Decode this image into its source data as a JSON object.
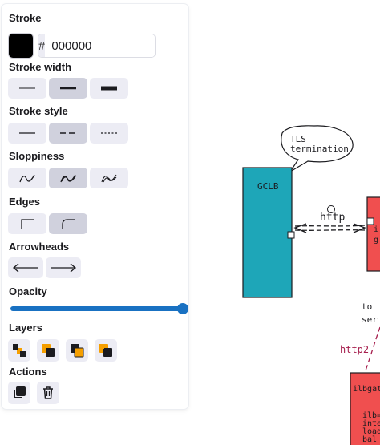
{
  "colors": {
    "accent": "#1971c2",
    "stroke_hex": "#000000",
    "gclb_fill": "#1ea6b8",
    "red_fill": "#f04f4f",
    "http2_text": "#a61e4d",
    "orange": "#f59f00"
  },
  "panel": {
    "stroke": {
      "title": "Stroke",
      "hash": "#",
      "value": "000000"
    },
    "stroke_width": {
      "title": "Stroke width",
      "options": [
        "thin",
        "bold",
        "extra-bold"
      ],
      "selected": 1
    },
    "stroke_style": {
      "title": "Stroke style",
      "options": [
        "solid",
        "dashed",
        "dotted"
      ],
      "selected": 1
    },
    "sloppiness": {
      "title": "Sloppiness",
      "options": [
        "architect",
        "artist",
        "cartoonist"
      ],
      "selected": 1
    },
    "edges": {
      "title": "Edges",
      "options": [
        "sharp",
        "round"
      ],
      "selected": 1
    },
    "arrowheads": {
      "title": "Arrowheads",
      "options": [
        "arrow-left-icon",
        "arrow-right-icon"
      ]
    },
    "opacity": {
      "title": "Opacity",
      "value": 100
    },
    "layers": {
      "title": "Layers",
      "options": [
        "send-to-back-icon",
        "send-backward-icon",
        "bring-forward-icon",
        "bring-to-front-icon"
      ]
    },
    "actions": {
      "title": "Actions",
      "options": [
        "duplicate-icon",
        "trash-icon"
      ]
    }
  },
  "canvas": {
    "bubble_line1": "TLS",
    "bubble_line2": "termination",
    "gclb_label": "GCLB",
    "http_label": "http",
    "red_box_line1": "i",
    "red_box_line2": "g",
    "to_line1": "to",
    "to_line2": "ser",
    "http2_label": "http2",
    "ilb_title": "ilbgate",
    "ilb_line1": "ilb=",
    "ilb_line2": "inte",
    "ilb_line3": "load",
    "ilb_line4": "bal"
  }
}
